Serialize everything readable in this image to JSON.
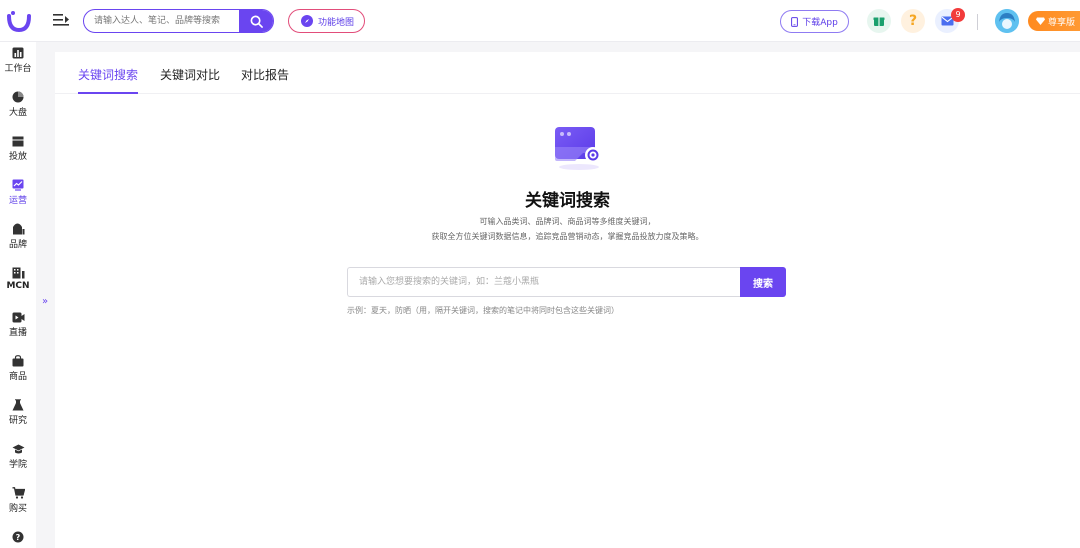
{
  "header": {
    "search_placeholder": "请输入达人、笔记、品牌等搜索",
    "function_map_label": "功能地图",
    "download_label": "下载App",
    "help_label": "?",
    "mail_badge": "9",
    "vip_label": "尊享版"
  },
  "sidebar": {
    "items": [
      {
        "label": "工作台",
        "icon": "dashboard-icon"
      },
      {
        "label": "大盘",
        "icon": "pie-chart-icon"
      },
      {
        "label": "投放",
        "icon": "folder-icon"
      },
      {
        "label": "运营",
        "icon": "trend-chart-icon"
      },
      {
        "label": "品牌",
        "icon": "shop-icon"
      },
      {
        "label": "MCN",
        "icon": "building-icon"
      },
      {
        "label": "直播",
        "icon": "video-icon"
      },
      {
        "label": "商品",
        "icon": "bag-icon"
      },
      {
        "label": "研究",
        "icon": "flask-icon"
      },
      {
        "label": "学院",
        "icon": "graduation-cap-icon"
      },
      {
        "label": "购买",
        "icon": "cart-icon"
      },
      {
        "label": "",
        "icon": "help-circle-icon"
      }
    ],
    "collapse_label": "»"
  },
  "tabs": [
    {
      "label": "关键词搜索",
      "active": true
    },
    {
      "label": "关键词对比",
      "active": false
    },
    {
      "label": "对比报告",
      "active": false
    }
  ],
  "hero": {
    "title": "关键词搜索",
    "desc_line1": "可输入品类词、品牌词、商品词等多维度关键词，",
    "desc_line2": "获取全方位关键词数据信息，追踪竞品营销动态，掌握竞品投放力度及策略。"
  },
  "keyword_search": {
    "placeholder": "请输入您想要搜索的关键词，如：兰蔻小黑瓶",
    "button_label": "搜索",
    "example": "示例：夏天，防晒（用，隔开关键词，搜索的笔记中将同时包含这些关键词）"
  },
  "colors": {
    "accent": "#6a45f0",
    "badge": "#f23b3b",
    "vip": "#ff8a1f"
  }
}
